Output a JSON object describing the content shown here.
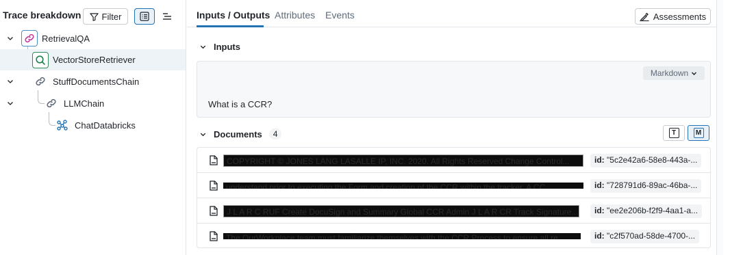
{
  "left_panel": {
    "title": "Trace breakdown",
    "filter_label": "Filter"
  },
  "tree": [
    {
      "label": "RetrievalQA",
      "icon": "link-icon",
      "expanded": true
    },
    {
      "label": "VectorStoreRetriever",
      "icon": "search-icon",
      "selected": true
    },
    {
      "label": "StuffDocumentsChain",
      "icon": "link-icon",
      "expanded": true
    },
    {
      "label": "LLMChain",
      "icon": "link-icon",
      "expanded": true
    },
    {
      "label": "ChatDatabricks",
      "icon": "model-icon"
    }
  ],
  "tabs": {
    "inputs_outputs": "Inputs / Outputs",
    "attributes": "Attributes",
    "events": "Events"
  },
  "assessments_label": "Assessments",
  "inputs": {
    "title": "Inputs",
    "format": "Markdown",
    "text": "What is a CCR?"
  },
  "documents": {
    "title": "Documents",
    "count": "4",
    "rows": [
      {
        "snippet": "COPYRIGHT © JONES LANG LASALLE IP, INC. 2020. All Rights Reserved Change Control...",
        "id_label": "id:",
        "id_value": "\"5c2e42a6-58e8-443a-..."
      },
      {
        "snippet": "understand prior to executing the Form and creation of the CCR within the tracker. A CC...",
        "id_label": "id:",
        "id_value": "\"728791d6-89ac-46ba-..."
      },
      {
        "snippet": "J L A R C RUF Create DocuSign and Summary Global CCR Admin J L A R CR Track Signature...",
        "id_label": "id:",
        "id_value": "\"ee2e206b-f2f9-4aa1-a..."
      },
      {
        "snippet": "The OurWorkplace team must familiarize themselves with the CCR Process to ensure all re...",
        "id_label": "id:",
        "id_value": "\"c2f570ad-58de-4700-..."
      }
    ]
  }
}
